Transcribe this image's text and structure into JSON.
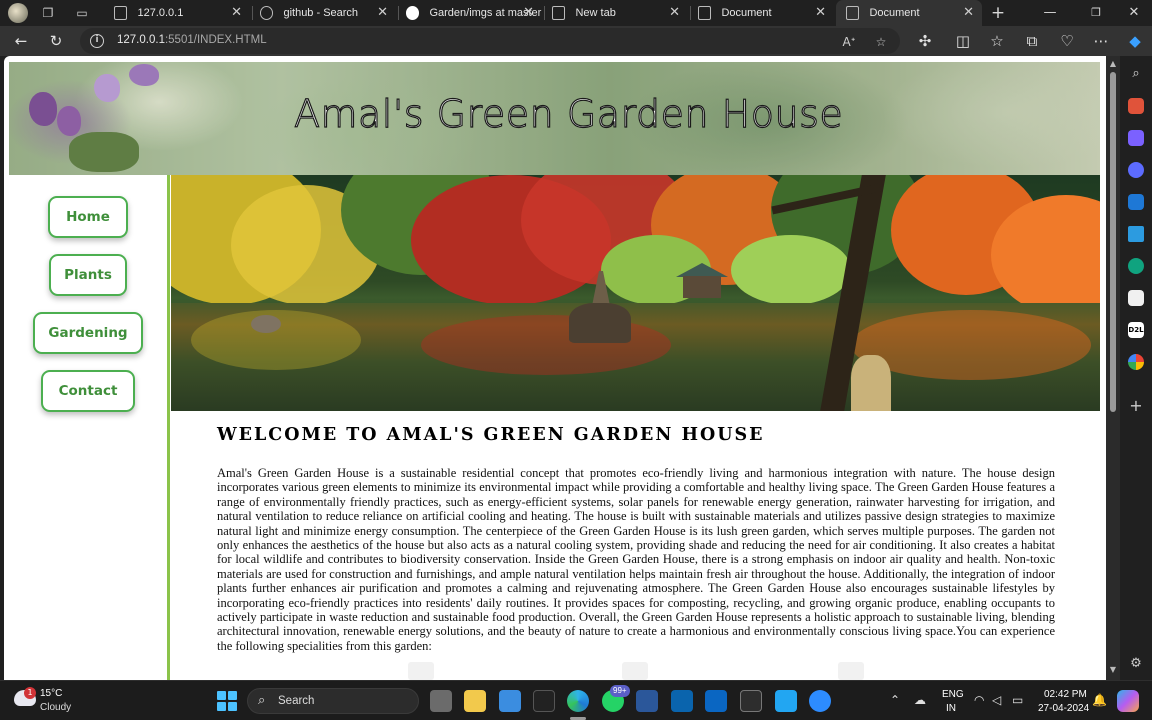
{
  "browser": {
    "tabs": [
      {
        "title": "127.0.0.1",
        "icon": "page-icon"
      },
      {
        "title": "github - Search",
        "icon": "search-icon"
      },
      {
        "title": "Garden/imgs at master",
        "icon": "github-icon"
      },
      {
        "title": "New tab",
        "icon": "newtab-icon"
      },
      {
        "title": "Document",
        "icon": "page-icon"
      },
      {
        "title": "Document",
        "icon": "page-icon",
        "active": true
      }
    ],
    "url_host": "127.0.0.1",
    "url_path": ":5501/INDEX.HTML",
    "accent": "#4caf50"
  },
  "page": {
    "banner_title": "Amal's Green Garden House",
    "nav": [
      {
        "label": "Home"
      },
      {
        "label": "Plants"
      },
      {
        "label": "Gardening"
      },
      {
        "label": "Contact"
      }
    ],
    "welcome_heading": "WELCOME TO AMAL'S GREEN GARDEN HOUSE",
    "paragraph": "Amal's Green Garden House is a sustainable residential concept that promotes eco-friendly living and harmonious integration with nature. The house design incorporates various green elements to minimize its environmental impact while providing a comfortable and healthy living space. The Green Garden House features a range of environmentally friendly practices, such as energy-efficient systems, solar panels for renewable energy generation, rainwater harvesting for irrigation, and natural ventilation to reduce reliance on artificial cooling and heating. The house is built with sustainable materials and utilizes passive design strategies to maximize natural light and minimize energy consumption. The centerpiece of the Green Garden House is its lush green garden, which serves multiple purposes. The garden not only enhances the aesthetics of the house but also acts as a natural cooling system, providing shade and reducing the need for air conditioning. It also creates a habitat for local wildlife and contributes to biodiversity conservation. Inside the Green Garden House, there is a strong emphasis on indoor air quality and health. Non-toxic materials are used for construction and furnishings, and ample natural ventilation helps maintain fresh air throughout the house. Additionally, the integration of indoor plants further enhances air purification and promotes a calming and rejuvenating atmosphere. The Green Garden House also encourages sustainable lifestyles by incorporating eco-friendly practices into residents' daily routines. It provides spaces for composting, recycling, and growing organic produce, enabling occupants to actively participate in waste reduction and sustainable food production. Overall, the Green Garden House represents a holistic approach to sustainable living, blending architectural innovation, renewable energy solutions, and the beauty of nature to create a harmonious and environmentally conscious living space.You can experience the following specialities from this garden:"
  },
  "taskbar": {
    "weather_temp": "15°C",
    "weather_desc": "Cloudy",
    "weather_badge": "1",
    "search_label": "Search",
    "badge_count": "99+",
    "lang_line1": "ENG",
    "lang_line2": "IN",
    "time": "02:42 PM",
    "date": "27-04-2024"
  }
}
